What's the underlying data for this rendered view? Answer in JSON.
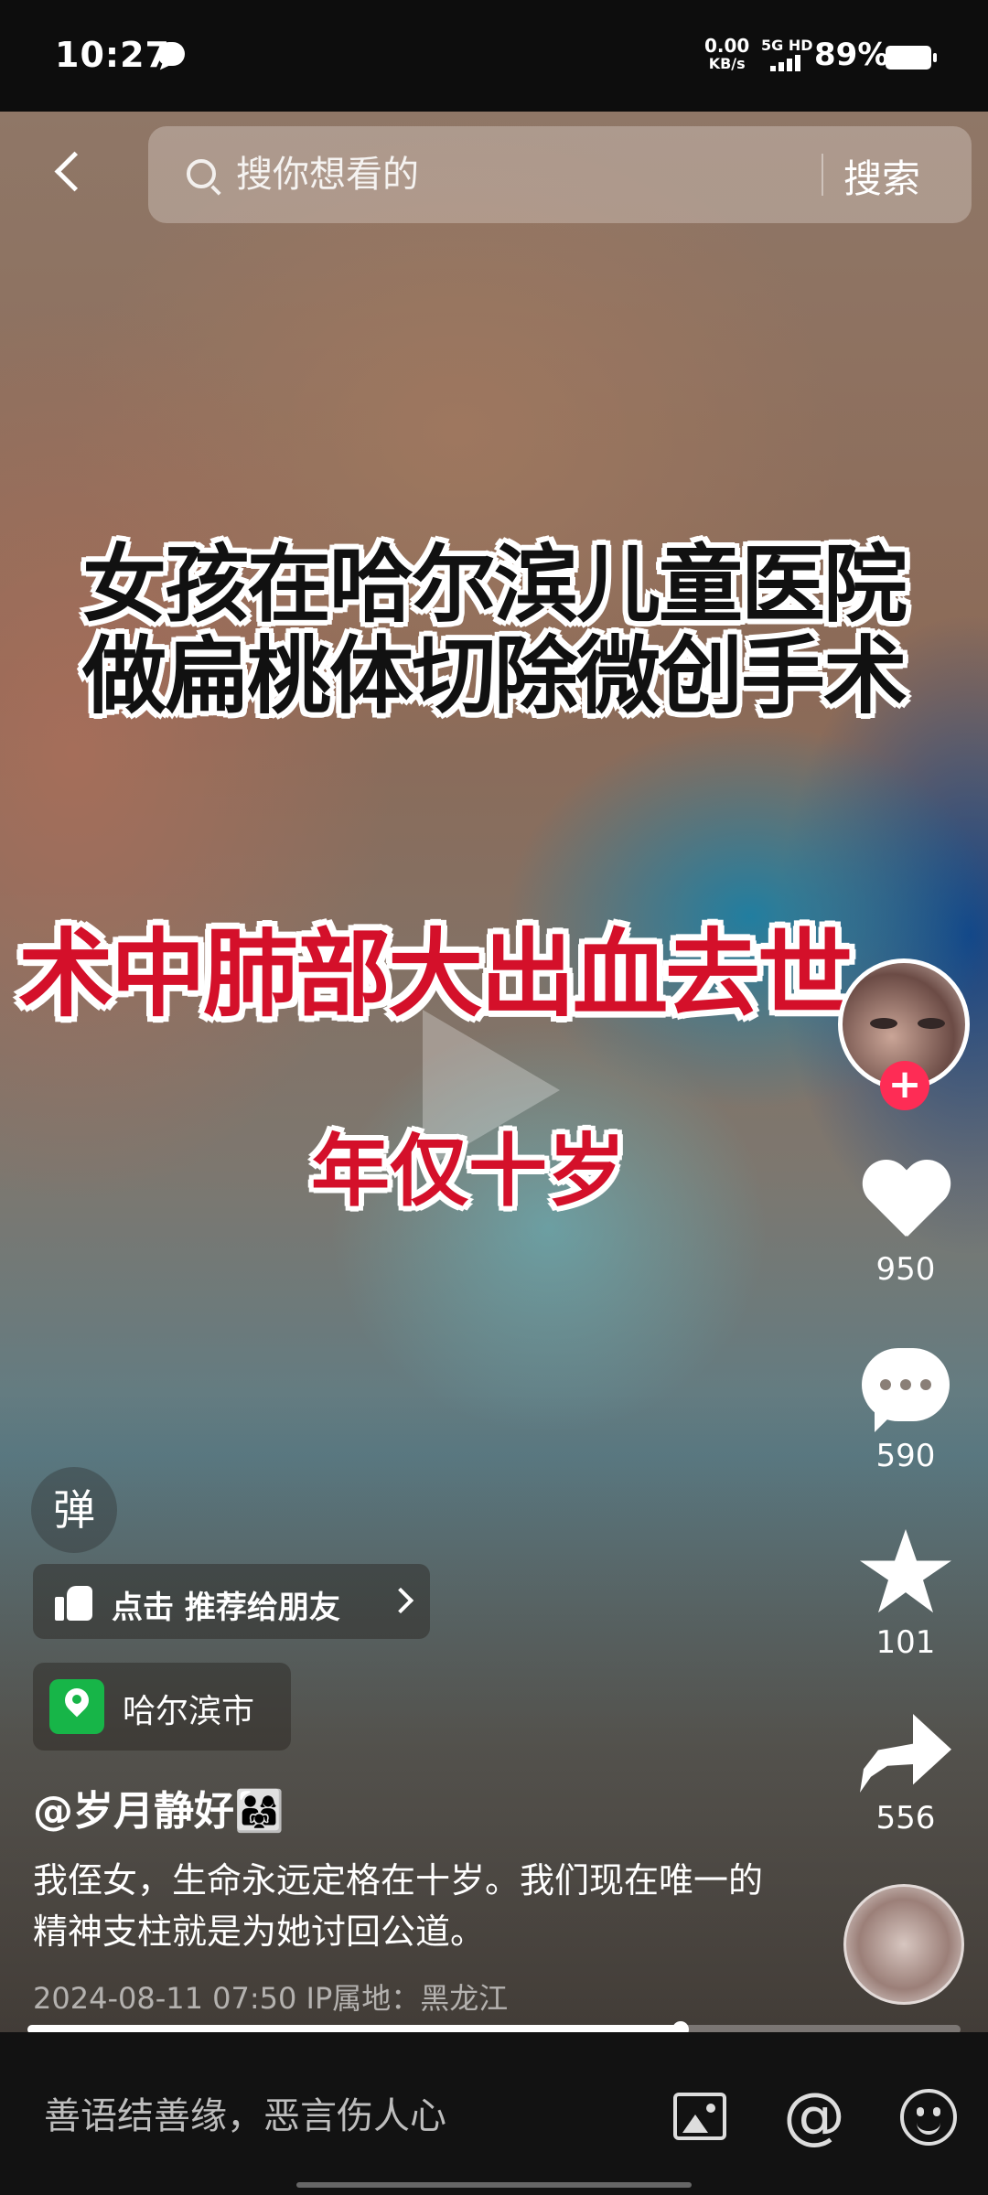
{
  "status_bar": {
    "time": "10:27",
    "net_speed_value": "0.00",
    "net_speed_unit": "KB/s",
    "net_type": "5G HD",
    "battery_percent": "89%"
  },
  "search": {
    "placeholder": "搜你想看的",
    "button_label": "搜索"
  },
  "video": {
    "caption_line1": "女孩在哈尔滨儿童医院",
    "caption_line2": "做扁桃体切除微创手术",
    "caption_red": "术中肺部大出血去世",
    "caption_age": "年仅十岁",
    "progress": 0.7
  },
  "right_rail": {
    "follow_label": "+",
    "like_count": "950",
    "comment_count": "590",
    "favorite_count": "101",
    "share_count": "556"
  },
  "left_overlay": {
    "danmaku_label": "弹",
    "recommend_label": "点击 推荐给朋友",
    "location": "哈尔滨市",
    "username": "@岁月静好👨‍👩‍👧",
    "description": "我侄女，生命永远定格在十岁。我们现在唯一的精神支柱就是为她讨回公道。",
    "meta": "2024-08-11 07:50  IP属地：黑龙江"
  },
  "comment_bar": {
    "placeholder": "善语结善缘，恶言伤人心",
    "at_symbol": "@"
  }
}
